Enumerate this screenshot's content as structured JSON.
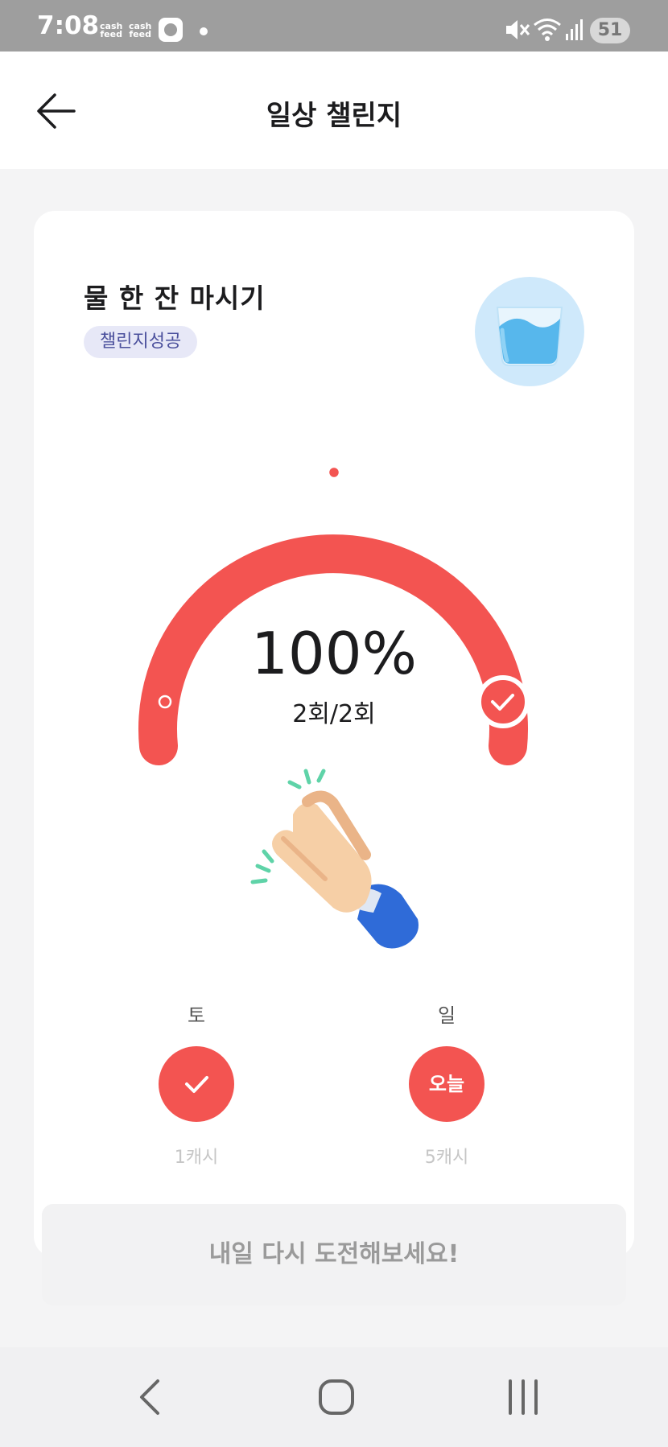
{
  "status_bar": {
    "time": "7:08",
    "cash_feed_1": "cash feed",
    "cash_feed_2": "cash feed",
    "battery": "51",
    "icons": [
      "app-icon",
      "notification-dot",
      "mute-icon",
      "wifi-icon",
      "signal-icon",
      "battery-icon"
    ]
  },
  "header": {
    "title": "일상 챌린지",
    "back_icon": "arrow-left-icon"
  },
  "challenge": {
    "title": "물 한 잔 마시기",
    "badge": "챌린지성공",
    "icon": "water-glass-icon",
    "progress_percent": 100,
    "progress_label": "100%",
    "count_label": "2회/2회",
    "accent_color": "#f35451"
  },
  "days": [
    {
      "label": "토",
      "state": "done",
      "circle_text": "",
      "reward": "1캐시"
    },
    {
      "label": "일",
      "state": "today",
      "circle_text": "오늘",
      "reward": "5캐시"
    }
  ],
  "footer": {
    "button_label": "내일 다시 도전해보세요!"
  },
  "nav_bar": {
    "icons": [
      "back-nav-icon",
      "home-nav-icon",
      "recents-nav-icon"
    ]
  }
}
